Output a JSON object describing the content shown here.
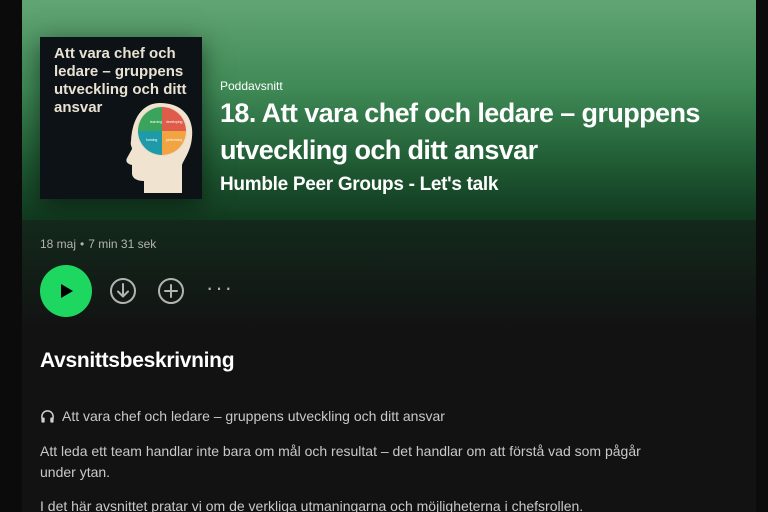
{
  "cover": {
    "title": "Att vara chef och ledare – gruppens utveckling och ditt ansvar",
    "quadrant_labels": [
      "learning",
      "developing",
      "performing",
      "forming"
    ]
  },
  "episode": {
    "type_label": "Poddavsnitt",
    "title": "18. Att vara chef och ledare – gruppens utveckling och ditt ansvar",
    "show": "Humble Peer Groups - Let's talk",
    "date": "18 maj",
    "duration": "7 min 31 sek"
  },
  "actions": {
    "play": "play-icon",
    "download": "download-icon",
    "add": "add-icon",
    "more": "···"
  },
  "description": {
    "heading": "Avsnittsbeskrivning",
    "icon": "headphones-icon",
    "line1": "Att vara chef och ledare – gruppens utveckling och ditt ansvar",
    "para1": "Att leda ett team handlar inte bara om mål och resultat – det handlar om att förstå vad som pågår under ytan.",
    "para2": "I det här avsnittet pratar vi om de verkliga utmaningarna och möjligheterna i chefsrollen."
  },
  "colors": {
    "accent": "#1ed760",
    "hero_top": "#62a574",
    "hero_bottom": "#11391f",
    "background": "#121212"
  }
}
